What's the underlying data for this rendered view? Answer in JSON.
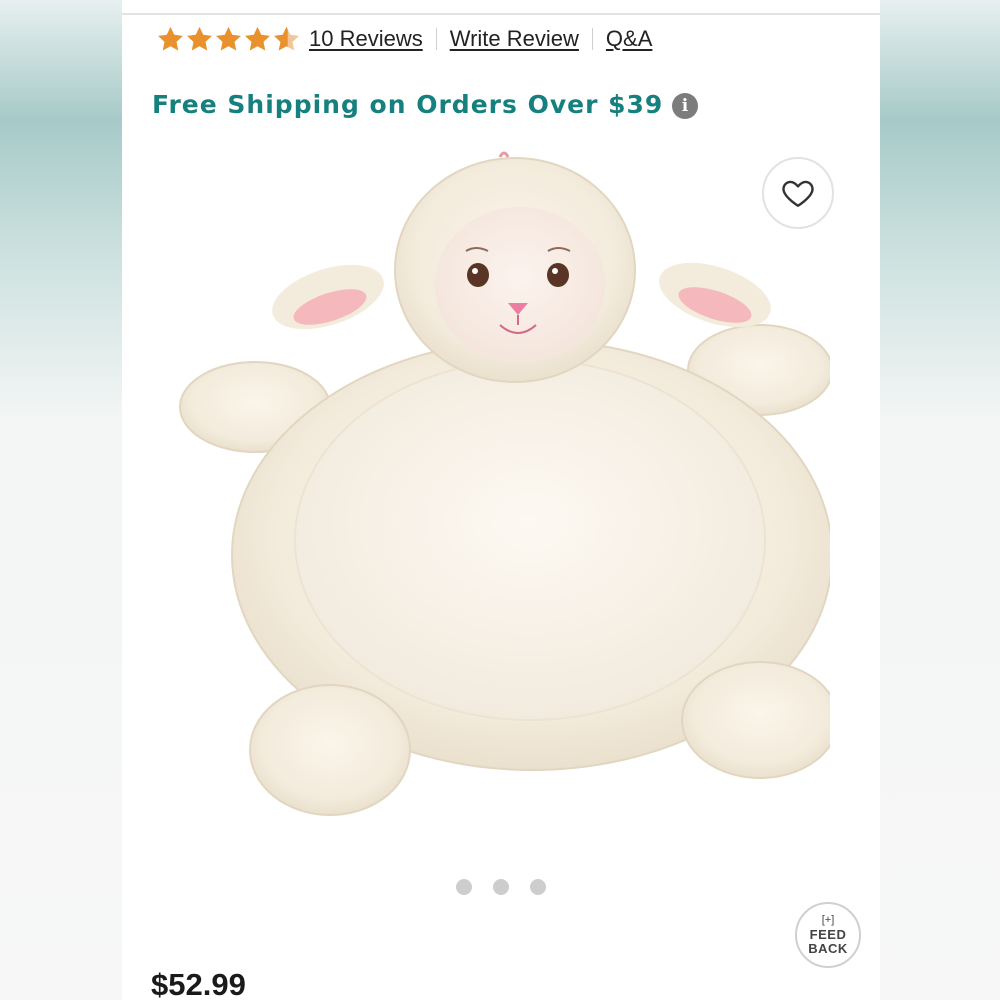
{
  "rating": {
    "stars_value": 4.5,
    "stars_max": 5,
    "star_color": "#e8912d",
    "reviews_label": "10 Reviews",
    "write_review_label": "Write Review",
    "qa_label": "Q&A"
  },
  "shipping": {
    "text": "Free Shipping on Orders Over $39",
    "color": "#16807f",
    "info_icon": "info-icon"
  },
  "product": {
    "image_subject": "plush lamb play mat",
    "wishlist_icon": "heart-icon",
    "carousel_dots": 3,
    "price": "$52.99"
  },
  "feedback": {
    "plus_label": "[+]",
    "line1": "FEED",
    "line2": "BACK"
  }
}
